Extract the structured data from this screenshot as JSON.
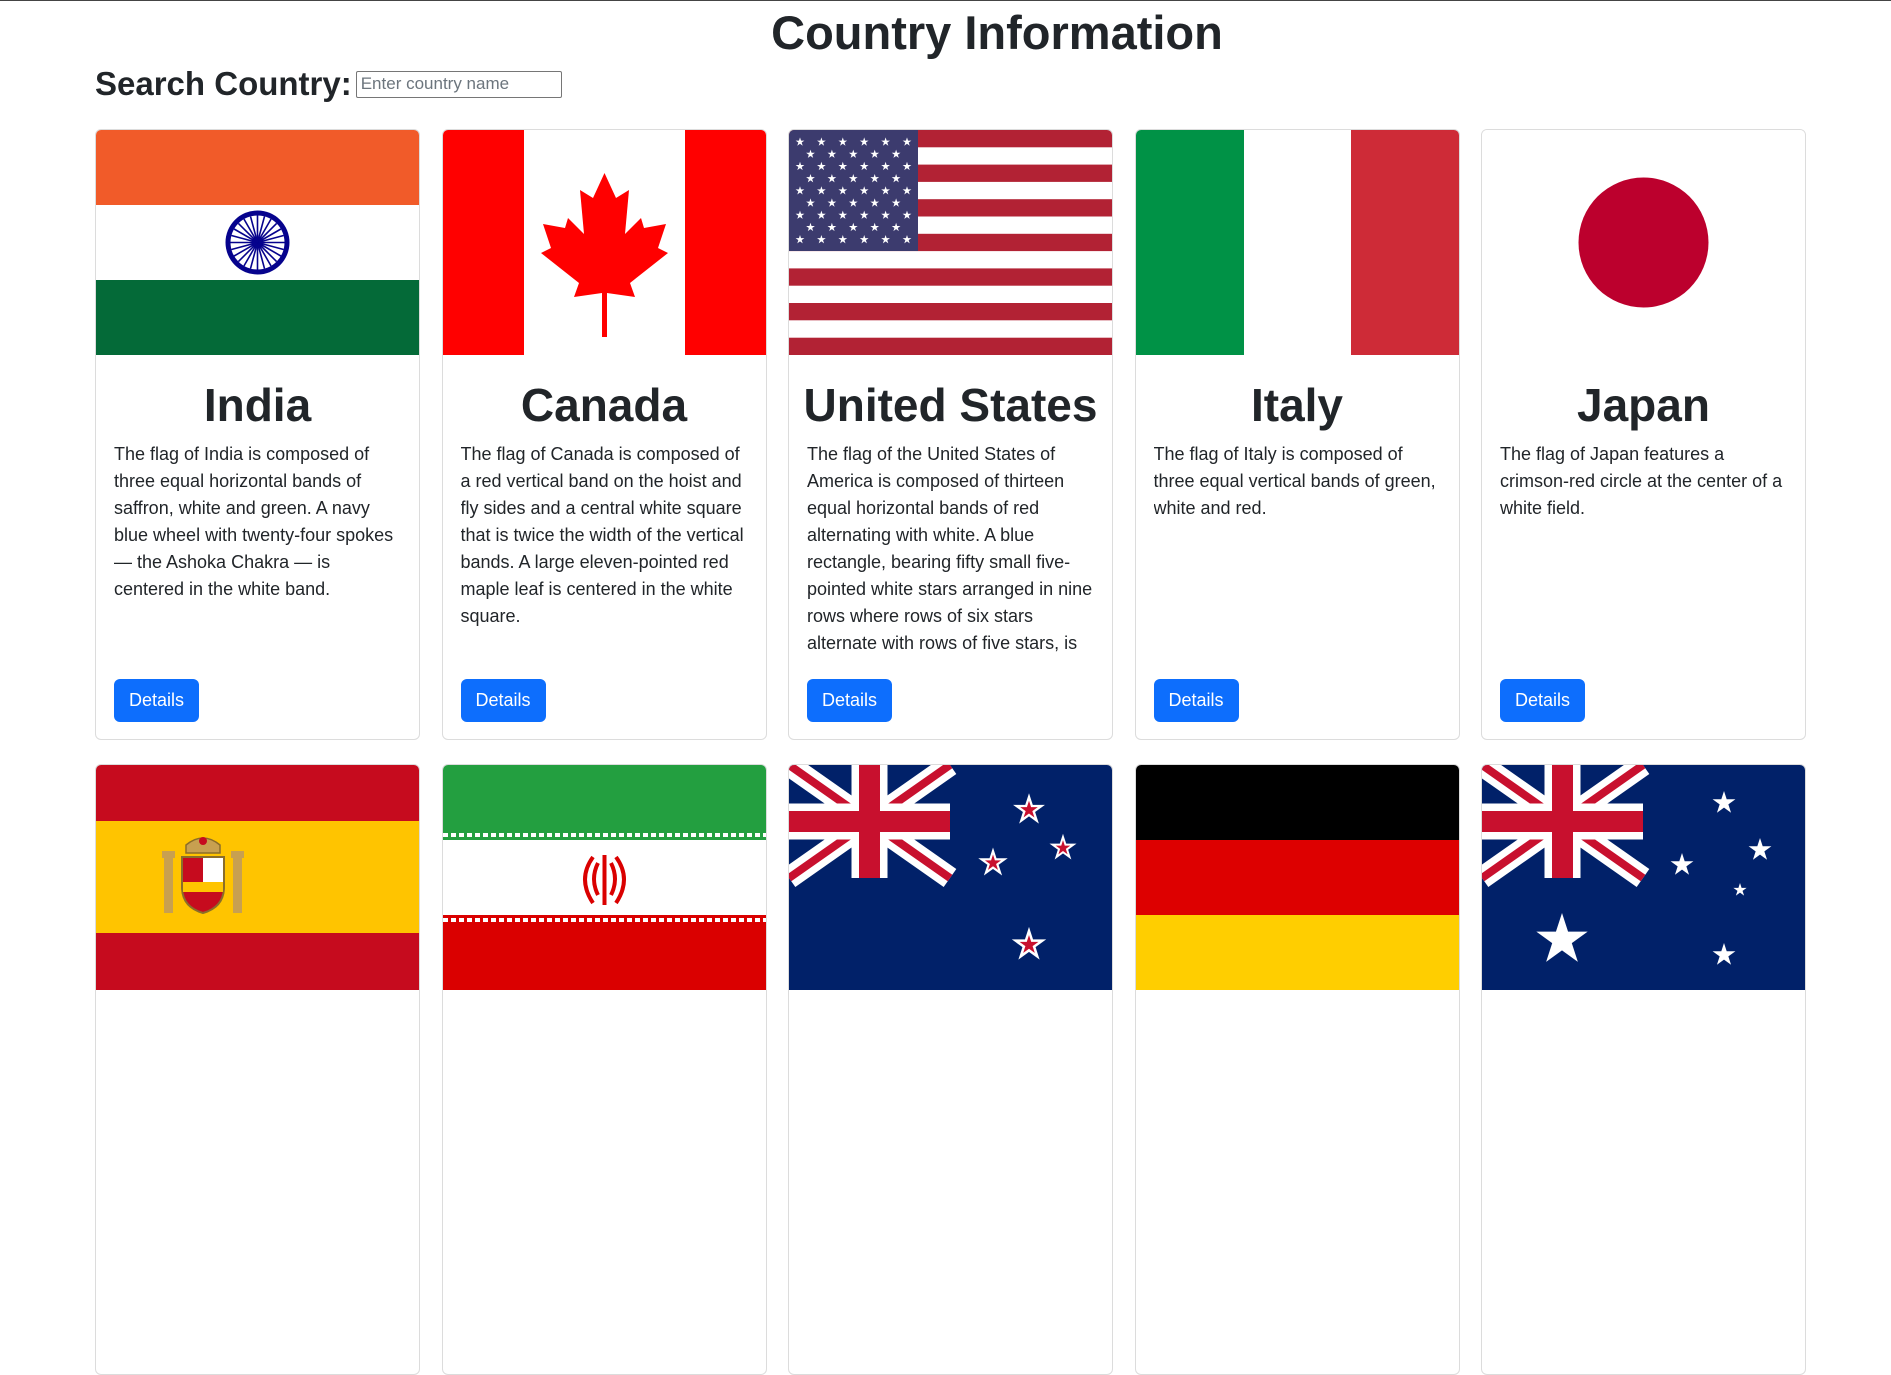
{
  "page": {
    "title": "Country Information"
  },
  "search": {
    "label": "Search Country:",
    "placeholder": "Enter country name",
    "value": ""
  },
  "colors": {
    "button": "#0d6efd",
    "text": "#212529"
  },
  "countries": [
    {
      "name": "India",
      "flag": "india-flag",
      "button": "Details",
      "description": "The flag of India is composed of three equal horizontal bands of saffron, white and green. A navy blue wheel with twenty-four spokes — the Ashoka Chakra — is centered in the white band."
    },
    {
      "name": "Canada",
      "flag": "canada-flag",
      "button": "Details",
      "description": "The flag of Canada is composed of a red vertical band on the hoist and fly sides and a central white square that is twice the width of the vertical bands. A large eleven-pointed red maple leaf is centered in the white square."
    },
    {
      "name": "United States",
      "flag": "usa-flag",
      "button": "Details",
      "description": "The flag of the United States of America is composed of thirteen equal horizontal bands of red alternating with white. A blue rectangle, bearing fifty small five-pointed white stars arranged in nine rows where rows of six stars alternate with rows of five stars, is ..."
    },
    {
      "name": "Italy",
      "flag": "italy-flag",
      "button": "Details",
      "description": "The flag of Italy is composed of three equal vertical bands of green, white and red."
    },
    {
      "name": "Japan",
      "flag": "japan-flag",
      "button": "Details",
      "description": "The flag of Japan features a crimson-red circle at the center of a white field."
    },
    {
      "name": "",
      "flag": "spain-flag",
      "button": "",
      "description": ""
    },
    {
      "name": "",
      "flag": "iran-flag",
      "button": "",
      "description": ""
    },
    {
      "name": "",
      "flag": "new-zealand-flag",
      "button": "",
      "description": ""
    },
    {
      "name": "",
      "flag": "germany-flag",
      "button": "",
      "description": ""
    },
    {
      "name": "",
      "flag": "australia-flag",
      "button": "",
      "description": ""
    }
  ]
}
